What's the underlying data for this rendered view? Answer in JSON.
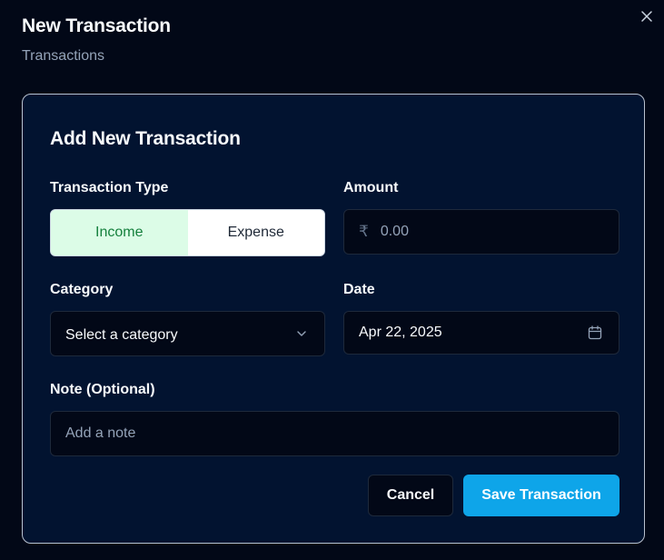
{
  "dialog": {
    "title": "New Transaction",
    "subtitle": "Transactions",
    "close_icon": "close-icon"
  },
  "form": {
    "title": "Add New Transaction",
    "transaction_type": {
      "label": "Transaction Type",
      "options": [
        "Income",
        "Expense"
      ],
      "selected": "Income",
      "selected_color": "#15803d"
    },
    "amount": {
      "label": "Amount",
      "currency_symbol": "₹",
      "placeholder": "0.00"
    },
    "category": {
      "label": "Category",
      "placeholder": "Select a category",
      "icon": "chevron-down-icon"
    },
    "date": {
      "label": "Date",
      "value": "Apr 22, 2025",
      "icon": "calendar-icon"
    },
    "note": {
      "label": "Note (Optional)",
      "placeholder": "Add a note"
    },
    "buttons": {
      "cancel": "Cancel",
      "save": "Save Transaction",
      "save_color": "#0ea5e9"
    }
  }
}
